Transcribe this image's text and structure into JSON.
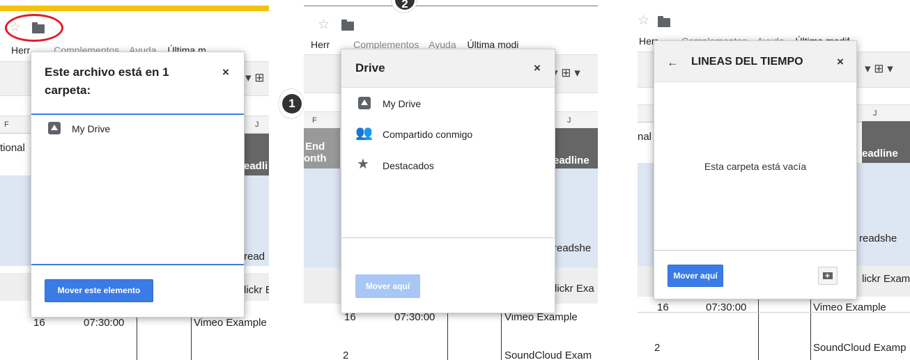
{
  "menu": {
    "herramientas": "Herramientas",
    "herr_partial": "Herr",
    "herr_start_partial": "Herr",
    "complementos": "Complementos",
    "ayuda": "Ayuda",
    "ultima": "Última m",
    "ultima_mod": "Última modi",
    "ultima_modif": "Última modif"
  },
  "sheet": {
    "col_f": "F",
    "col_j": "J",
    "tional": "tional",
    "nal": "nal",
    "end": "End",
    "month": "onth",
    "eadli": "eadli",
    "eadline": "eadline",
    "eadline3": "eadline",
    "read": "read",
    "readshe": "readshe",
    "readshet": "readshe",
    "lickr": "lickr E",
    "lickr_exa": "lickr Exa",
    "lickr_exam": "lickr Exam",
    "row16": "16",
    "time": "07:30:00",
    "vimeo": "Vimeo Example",
    "vimeo_ex": "Vimeo Example",
    "row2": "2",
    "soundcloud": "SoundCloud Examp",
    "soundcloud2": "SoundCloud Exam"
  },
  "step_badges": [
    "1",
    "2"
  ],
  "dialog1": {
    "title": "Este archivo está en 1 carpeta:",
    "close": "×",
    "item": "My Drive",
    "button": "Mover este elemento"
  },
  "dialog2": {
    "title": "Drive",
    "close": "×",
    "items": [
      "My Drive",
      "Compartido conmigo",
      "Destacados"
    ],
    "button": "Mover aquí"
  },
  "dialog3": {
    "back": "←",
    "title": "LINEAS DEL TIEMPO",
    "close": "×",
    "empty": "Esta carpeta está vacía",
    "button": "Mover aquí"
  },
  "colors": {
    "accent": "#3b7be6",
    "highlight": "#e31b23",
    "toolbar_yellow": "#f4c20d"
  }
}
